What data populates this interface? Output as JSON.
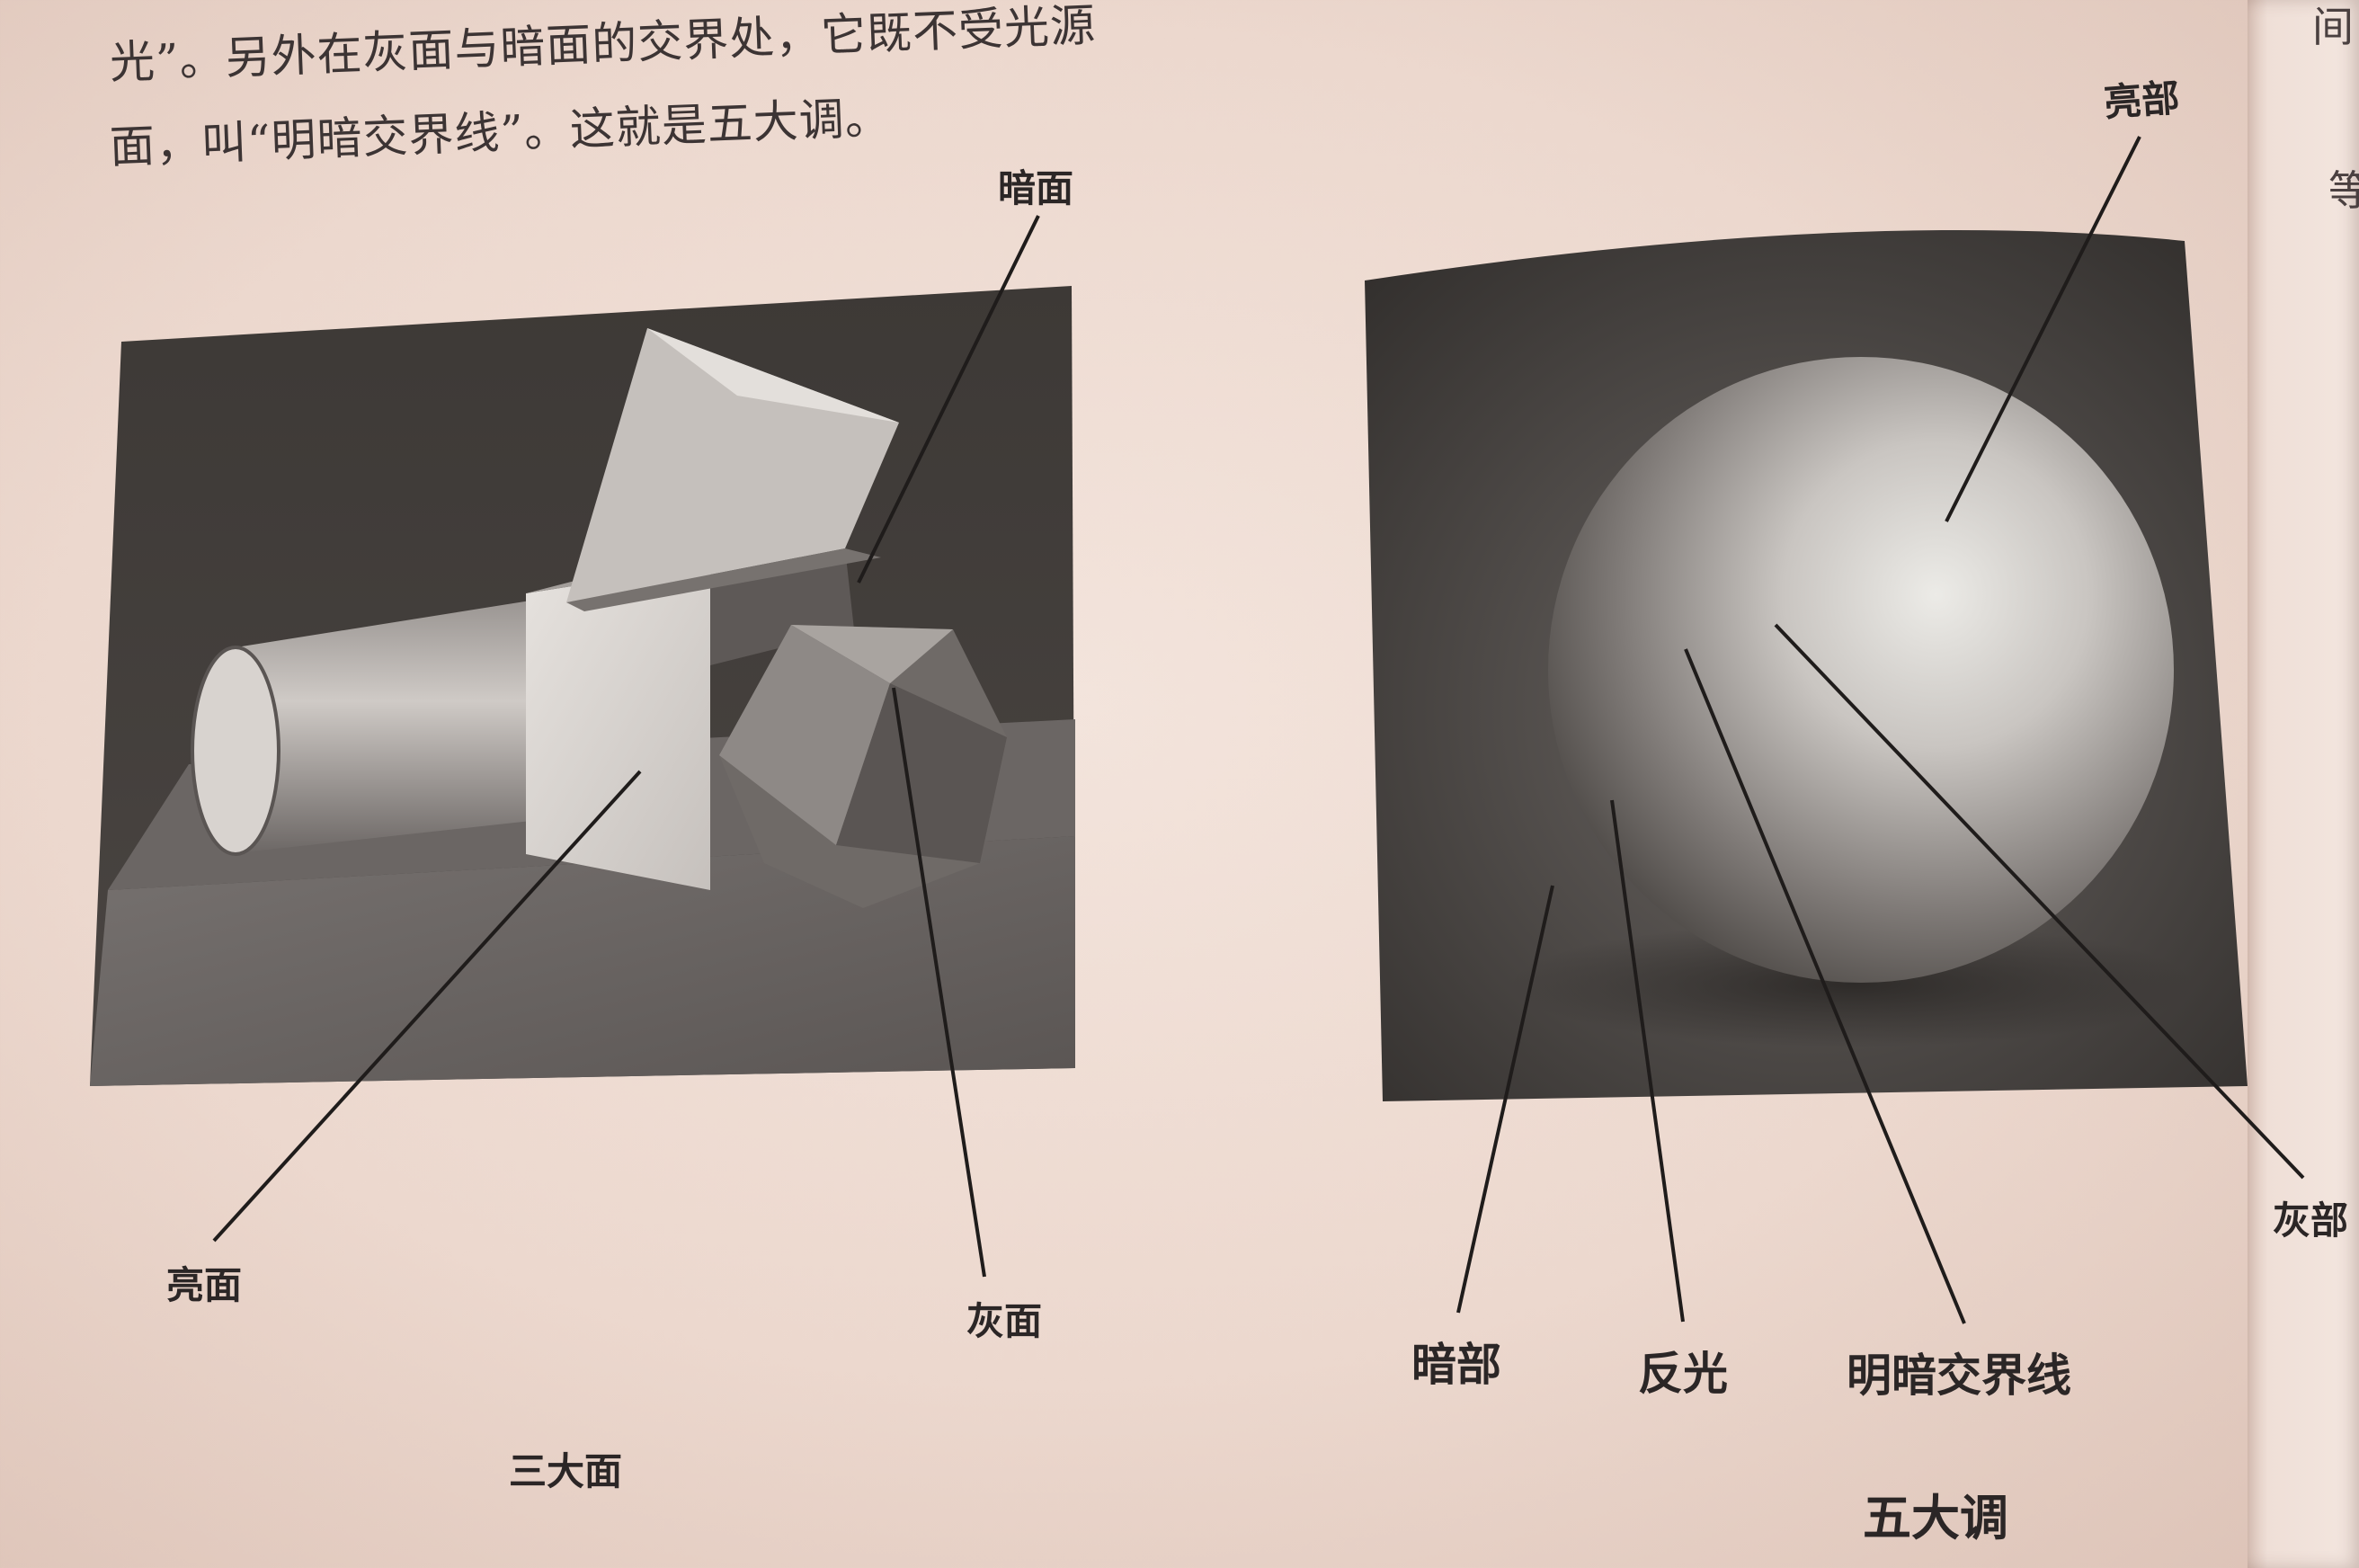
{
  "text": {
    "line1": "光”。另外在灰面与暗面的交界处，它既不受光源",
    "line2": "面，叫“明暗交界线”。这就是五大调。"
  },
  "edge": {
    "top": "间",
    "middle": "等"
  },
  "left_figure": {
    "caption": "三大面",
    "labels": {
      "dark_face": "暗面",
      "light_face": "亮面",
      "gray_face": "灰面"
    }
  },
  "right_figure": {
    "caption": "五大调",
    "labels": {
      "highlight": "亮部",
      "gray": "灰部",
      "dark": "暗部",
      "reflected_light": "反光",
      "terminator": "明暗交界线"
    }
  },
  "colors": {
    "paper": "#ecd8ce",
    "ink": "#2b2626",
    "drawing_dark": "#3a3634",
    "drawing_light": "#e8e4e0"
  }
}
